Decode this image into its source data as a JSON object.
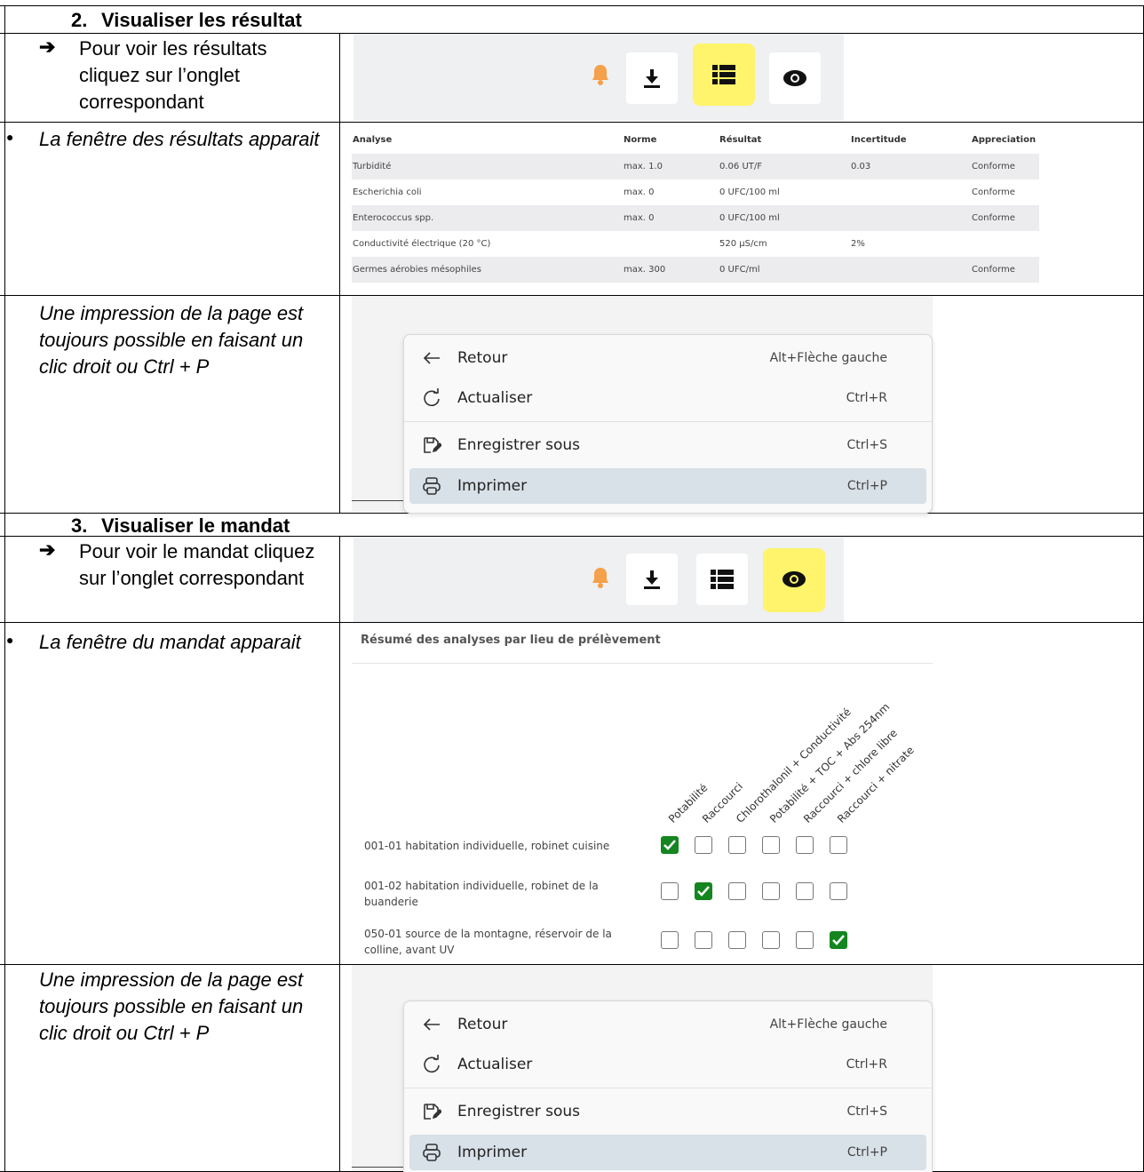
{
  "section2": {
    "number": "2.",
    "title": "Visualiser les résultat",
    "instruction": "Pour voir les résultats cliquez sur l’onglet correspondant",
    "window_note": "La fenêtre des résultats apparait",
    "print_note": "Une impression de la page est toujours possible en faisant un clic droit ou Ctrl + P"
  },
  "section3": {
    "number": "3.",
    "title": "Visualiser le mandat",
    "instruction": "Pour voir le mandat cliquez sur l’onglet correspondant",
    "window_note": "La fenêtre du mandat apparait",
    "print_note": "Une impression de la page est toujours possible en faisant un clic droit ou Ctrl + P"
  },
  "toolbar": {
    "icons": [
      "bell-icon",
      "download-icon",
      "list-icon",
      "eye-icon"
    ],
    "highlight_color": "#fff46b",
    "bell_color": "#f5a04a"
  },
  "results_table": {
    "headers": [
      "Analyse",
      "Norme",
      "Résultat",
      "Incertitude",
      "Appreciation"
    ],
    "rows": [
      [
        "Turbidité",
        "max. 1.0",
        "0.06 UT/F",
        "0.03",
        "Conforme"
      ],
      [
        "Escherichia coli",
        "max. 0",
        "0 UFC/100 ml",
        "",
        "Conforme"
      ],
      [
        "Enterococcus spp.",
        "max. 0",
        "0 UFC/100 ml",
        "",
        "Conforme"
      ],
      [
        "Conductivité électrique (20 °C)",
        "",
        "520 µS/cm",
        "2%",
        ""
      ],
      [
        "Germes aérobies mésophiles",
        "max. 300",
        "0 UFC/ml",
        "",
        "Conforme"
      ]
    ]
  },
  "context_menu": {
    "items": [
      {
        "label": "Retour",
        "shortcut": "Alt+Flèche gauche",
        "icon": "arrow-left-icon"
      },
      {
        "label": "Actualiser",
        "shortcut": "Ctrl+R",
        "icon": "refresh-icon"
      },
      {
        "label": "Enregistrer sous",
        "shortcut": "Ctrl+S",
        "icon": "save-as-icon"
      },
      {
        "label": "Imprimer",
        "shortcut": "Ctrl+P",
        "icon": "printer-icon"
      }
    ]
  },
  "mandat": {
    "title": "Résumé des analyses par lieu de prélèvement",
    "columns": [
      "Potabilité",
      "Raccourci",
      "Chlorothalonil + Conductivité",
      "Potabilité + TOC + Abs 254nm",
      "Raccourci + chlore libre",
      "Raccourci + nitrate"
    ],
    "rows": [
      {
        "label": "001-01 habitation individuelle, robinet cuisine",
        "checked": [
          true,
          false,
          false,
          false,
          false,
          false
        ]
      },
      {
        "label": "001-02 habitation individuelle, robinet de la buanderie",
        "checked": [
          false,
          true,
          false,
          false,
          false,
          false
        ]
      },
      {
        "label": "050-01 source de la montagne, réservoir de la colline, avant UV",
        "checked": [
          false,
          false,
          false,
          false,
          false,
          true
        ]
      }
    ],
    "check_color": "#14851f"
  }
}
